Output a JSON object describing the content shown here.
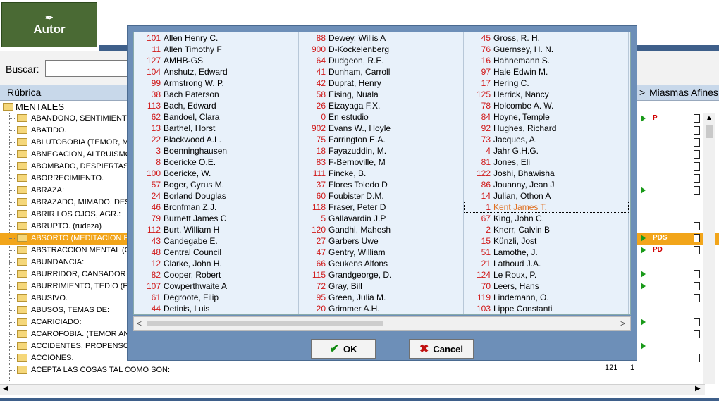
{
  "header": {
    "autor_label": "Autor",
    "search_label": "Buscar:",
    "search_value": ""
  },
  "grid_headers": {
    "rubrica": "Rúbrica",
    "arrow": ">",
    "miasmas": "Miasmas",
    "afines": "Afines"
  },
  "tree": {
    "root": "MENTALES",
    "items": [
      "ABANDONO, SENTIMIENTOS",
      "ABATIDO.",
      "ABLUTOBOBIA (TEMOR, MIE",
      "ABNEGACION, ALTRUISMO:",
      "ABOMBADO, DESPIERTASE",
      "ABORRECIMIENTO.",
      "ABRAZA:",
      "ABRAZADO, MIMADO, DESE",
      "ABRIR LOS OJOS, AGR.:",
      "ABRUPTO. (rudeza)",
      "ABSORTO (MEDITACION PR",
      "ABSTRACCION MENTAL (CO",
      "ABUNDANCIA:",
      "ABURRIDOR, CANSADOR (c",
      "ABURRIMIENTO, TEDIO (Falt",
      "ABUSIVO.",
      "ABUSOS, TEMAS DE:",
      "ACARICIADO:",
      "ACAROFOBIA. (TEMOR ANO",
      "ACCIDENTES, PROPENSO A",
      "ACCIONES.",
      "ACEPTA LAS COSAS TAL COMO SON:"
    ],
    "selected_index": 10,
    "last_row_cells": [
      "121",
      "1"
    ]
  },
  "right_rows": [
    {
      "play": true,
      "miasma": "P",
      "doc": true
    },
    {
      "play": false,
      "miasma": "",
      "doc": true
    },
    {
      "play": false,
      "miasma": "",
      "doc": true
    },
    {
      "play": false,
      "miasma": "",
      "doc": true
    },
    {
      "play": false,
      "miasma": "",
      "doc": true
    },
    {
      "play": false,
      "miasma": "",
      "doc": true
    },
    {
      "play": true,
      "miasma": "",
      "doc": true
    },
    {
      "play": false,
      "miasma": "",
      "doc": false
    },
    {
      "play": false,
      "miasma": "",
      "doc": false
    },
    {
      "play": false,
      "miasma": "",
      "doc": true
    },
    {
      "play": true,
      "miasma": "PDS",
      "doc": true
    },
    {
      "play": true,
      "miasma": "PD",
      "doc": true
    },
    {
      "play": false,
      "miasma": "",
      "doc": false
    },
    {
      "play": true,
      "miasma": "",
      "doc": true
    },
    {
      "play": true,
      "miasma": "",
      "doc": true
    },
    {
      "play": false,
      "miasma": "",
      "doc": true
    },
    {
      "play": false,
      "miasma": "",
      "doc": false
    },
    {
      "play": true,
      "miasma": "",
      "doc": true
    },
    {
      "play": false,
      "miasma": "",
      "doc": true
    },
    {
      "play": true,
      "miasma": "",
      "doc": false
    },
    {
      "play": false,
      "miasma": "",
      "doc": true
    },
    {
      "play": false,
      "miasma": "",
      "doc": false
    }
  ],
  "dialog": {
    "ok_label": "OK",
    "cancel_label": "Cancel",
    "columns": [
      [
        [
          "101",
          "Allen Henry C."
        ],
        [
          "11",
          "Allen Timothy F"
        ],
        [
          "127",
          "AMHB-GS"
        ],
        [
          "104",
          "Anshutz, Edward"
        ],
        [
          "99",
          "Armstrong W. P."
        ],
        [
          "38",
          "Bach Paterson"
        ],
        [
          "113",
          "Bach, Edward"
        ],
        [
          "62",
          "Bandoel, Clara"
        ],
        [
          "13",
          "Barthel, Horst"
        ],
        [
          "22",
          "Blackwood A.L."
        ],
        [
          "3",
          "Boenninghausen"
        ],
        [
          "8",
          "Boericke O.E."
        ],
        [
          "100",
          "Boericke, W."
        ],
        [
          "57",
          "Boger, Cyrus M."
        ],
        [
          "24",
          "Borland Douglas"
        ],
        [
          "46",
          "Bronfman Z.J."
        ],
        [
          "79",
          "Burnett James C"
        ],
        [
          "112",
          "Burt, William H"
        ],
        [
          "43",
          "Candegabe E."
        ],
        [
          "48",
          "Central Council"
        ],
        [
          "12",
          "Clarke, John H."
        ],
        [
          "82",
          "Cooper, Robert"
        ],
        [
          "107",
          "Cowperthwaite A"
        ],
        [
          "61",
          "Degroote, Filip"
        ],
        [
          "44",
          "Detinis, Luis"
        ]
      ],
      [
        [
          "88",
          "Dewey, Willis A"
        ],
        [
          "900",
          "D-Kockelenberg"
        ],
        [
          "64",
          "Dudgeon, R.E."
        ],
        [
          "41",
          "Dunham, Carroll"
        ],
        [
          "42",
          "Duprat, Henry"
        ],
        [
          "58",
          "Eising, Nuala"
        ],
        [
          "26",
          "Eizayaga F.X."
        ],
        [
          "0",
          "En estudio"
        ],
        [
          "902",
          "Evans W., Hoyle"
        ],
        [
          "75",
          "Farrington E.A."
        ],
        [
          "18",
          "Fayazuddin, M."
        ],
        [
          "83",
          "F-Bernoville, M"
        ],
        [
          "111",
          "Fincke, B."
        ],
        [
          "37",
          "Flores Toledo D"
        ],
        [
          "60",
          "Foubister D.M."
        ],
        [
          "118",
          "Fraser, Peter D"
        ],
        [
          "5",
          "Gallavardin J.P"
        ],
        [
          "120",
          "Gandhi, Mahesh"
        ],
        [
          "27",
          "Garbers Uwe"
        ],
        [
          "47",
          "Gentry, William"
        ],
        [
          "66",
          "Geukens Alfons"
        ],
        [
          "115",
          "Grandgeorge, D."
        ],
        [
          "72",
          "Gray, Bill"
        ],
        [
          "95",
          "Green, Julia M."
        ],
        [
          "20",
          "Grimmer A.H."
        ]
      ],
      [
        [
          "45",
          "Gross, R. H."
        ],
        [
          "76",
          "Guernsey, H. N."
        ],
        [
          "16",
          "Hahnemann S."
        ],
        [
          "97",
          "Hale Edwin M."
        ],
        [
          "17",
          "Hering C."
        ],
        [
          "125",
          "Herrick, Nancy"
        ],
        [
          "78",
          "Holcombe A. W."
        ],
        [
          "84",
          "Hoyne, Temple"
        ],
        [
          "92",
          "Hughes, Richard"
        ],
        [
          "73",
          "Jacques, A."
        ],
        [
          "4",
          "Jahr G.H.G."
        ],
        [
          "81",
          "Jones, Eli"
        ],
        [
          "122",
          "Joshi, Bhawisha"
        ],
        [
          "86",
          "Jouanny, Jean J"
        ],
        [
          "14",
          "Julian, Othon A"
        ],
        [
          "1",
          "Kent James T."
        ],
        [
          "67",
          "King, John C."
        ],
        [
          "2",
          "Knerr, Calvin B"
        ],
        [
          "15",
          "Künzli, Jost"
        ],
        [
          "51",
          "Lamothe, J."
        ],
        [
          "21",
          "Lathoud J.A."
        ],
        [
          "124",
          "Le Roux, P."
        ],
        [
          "70",
          "Leers, Hans"
        ],
        [
          "119",
          "Lindemann, O."
        ],
        [
          "103",
          "Lippe Constanti"
        ]
      ]
    ],
    "focused": {
      "col": 2,
      "row": 15
    }
  }
}
